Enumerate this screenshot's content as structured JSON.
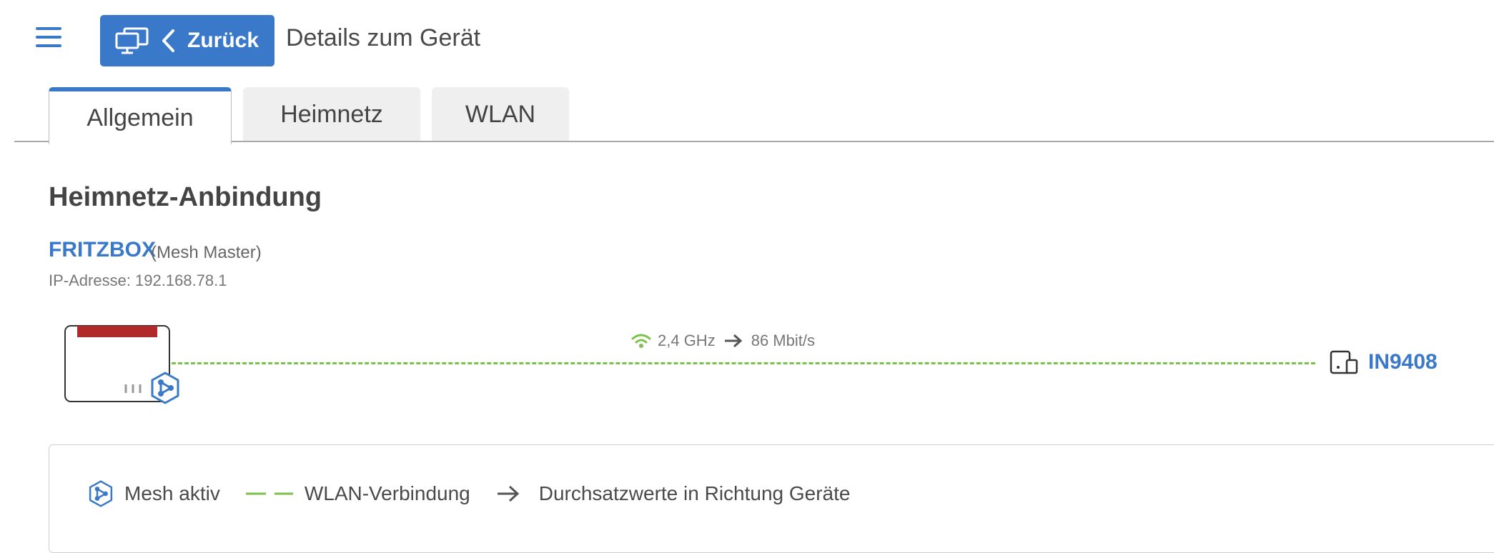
{
  "header": {
    "back_label": "Zurück",
    "title": "Details zum Gerät"
  },
  "tabs": [
    {
      "label": "Allgemein",
      "active": true
    },
    {
      "label": "Heimnetz",
      "active": false
    },
    {
      "label": "WLAN",
      "active": false
    }
  ],
  "section": {
    "title": "Heimnetz-Anbindung"
  },
  "master": {
    "name": "FRITZBOX",
    "role": "(Mesh Master)",
    "ip": "IP-Adresse: 192.168.78.1"
  },
  "connection": {
    "frequency": "2,4 GHz",
    "throughput": "86 Mbit/s",
    "type": "WLAN"
  },
  "client": {
    "name": "IN9408",
    "icon": "tablet-phone-icon"
  },
  "legend": {
    "mesh": "Mesh aktiv",
    "wlan": "WLAN-Verbindung",
    "throughput": "Durchsatzwerte in Richtung Geräte"
  },
  "colors": {
    "accent": "#3a78c9",
    "wlan_line": "#7cc24a",
    "router_red": "#b02a2a"
  }
}
